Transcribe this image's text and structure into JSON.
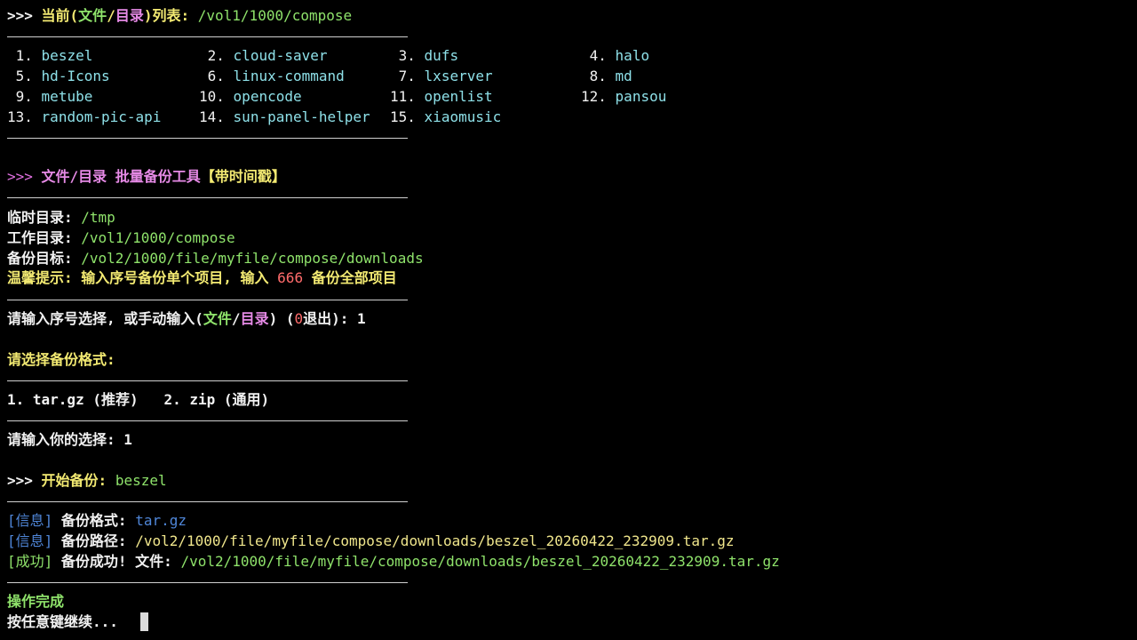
{
  "header": {
    "prompt": ">>> ",
    "label_a": "当前(",
    "word_file": "文件",
    "slash": "/",
    "word_dir": "目录",
    "label_b": ")列表:",
    "path": " /vol1/1000/compose"
  },
  "list_items": [
    {
      "num": " 1.",
      "name": "beszel"
    },
    {
      "num": " 2.",
      "name": "cloud-saver"
    },
    {
      "num": " 3.",
      "name": "dufs"
    },
    {
      "num": " 4.",
      "name": "halo"
    },
    {
      "num": " 5.",
      "name": "hd-Icons"
    },
    {
      "num": " 6.",
      "name": "linux-command"
    },
    {
      "num": " 7.",
      "name": "lxserver"
    },
    {
      "num": " 8.",
      "name": "md"
    },
    {
      "num": " 9.",
      "name": "metube"
    },
    {
      "num": "10.",
      "name": "opencode"
    },
    {
      "num": "11.",
      "name": "openlist"
    },
    {
      "num": "12.",
      "name": "pansou"
    },
    {
      "num": "13.",
      "name": "random-pic-api"
    },
    {
      "num": "14.",
      "name": "sun-panel-helper"
    },
    {
      "num": "15.",
      "name": "xiaomusic"
    }
  ],
  "tool_title": {
    "prompt": ">>> ",
    "name": "文件/目录 批量备份工具",
    "tag": "【带时间戳】"
  },
  "config": {
    "temp_label": "临时目录:",
    "temp_value": " /tmp",
    "work_label": "工作目录:",
    "work_value": " /vol1/1000/compose",
    "target_label": "备份目标:",
    "target_value": " /vol2/1000/file/myfile/compose/downloads",
    "tip_a": "温馨提示: 输入序号备份单个项目, 输入 ",
    "tip_num": "666",
    "tip_b": " 备份全部项目"
  },
  "input_prompt": {
    "a": "请输入序号选择, 或手动输入(",
    "file": "文件",
    "slash": "/",
    "dir": "目录",
    "b": ") (",
    "zero": "0",
    "c": "退出): ",
    "value": "1"
  },
  "format_prompt": "请选择备份格式:",
  "format_options": "1. tar.gz (推荐)   2. zip (通用)",
  "choice_prompt": {
    "label": "请输入你的选择: ",
    "value": "1"
  },
  "start": {
    "prompt": ">>> ",
    "label": "开始备份: ",
    "target": "beszel"
  },
  "logs": [
    {
      "tag": "[信息]",
      "label": " 备份格式: ",
      "value": "tar.gz"
    },
    {
      "tag": "[信息]",
      "label": " 备份路径: ",
      "value": "/vol2/1000/file/myfile/compose/downloads/beszel_20260422_232909.tar.gz"
    },
    {
      "tag": "[成功]",
      "label": " 备份成功! 文件: ",
      "value": "/vol2/1000/file/myfile/compose/downloads/beszel_20260422_232909.tar.gz"
    }
  ],
  "done": "操作完成",
  "continue_prompt": "按任意键继续..."
}
